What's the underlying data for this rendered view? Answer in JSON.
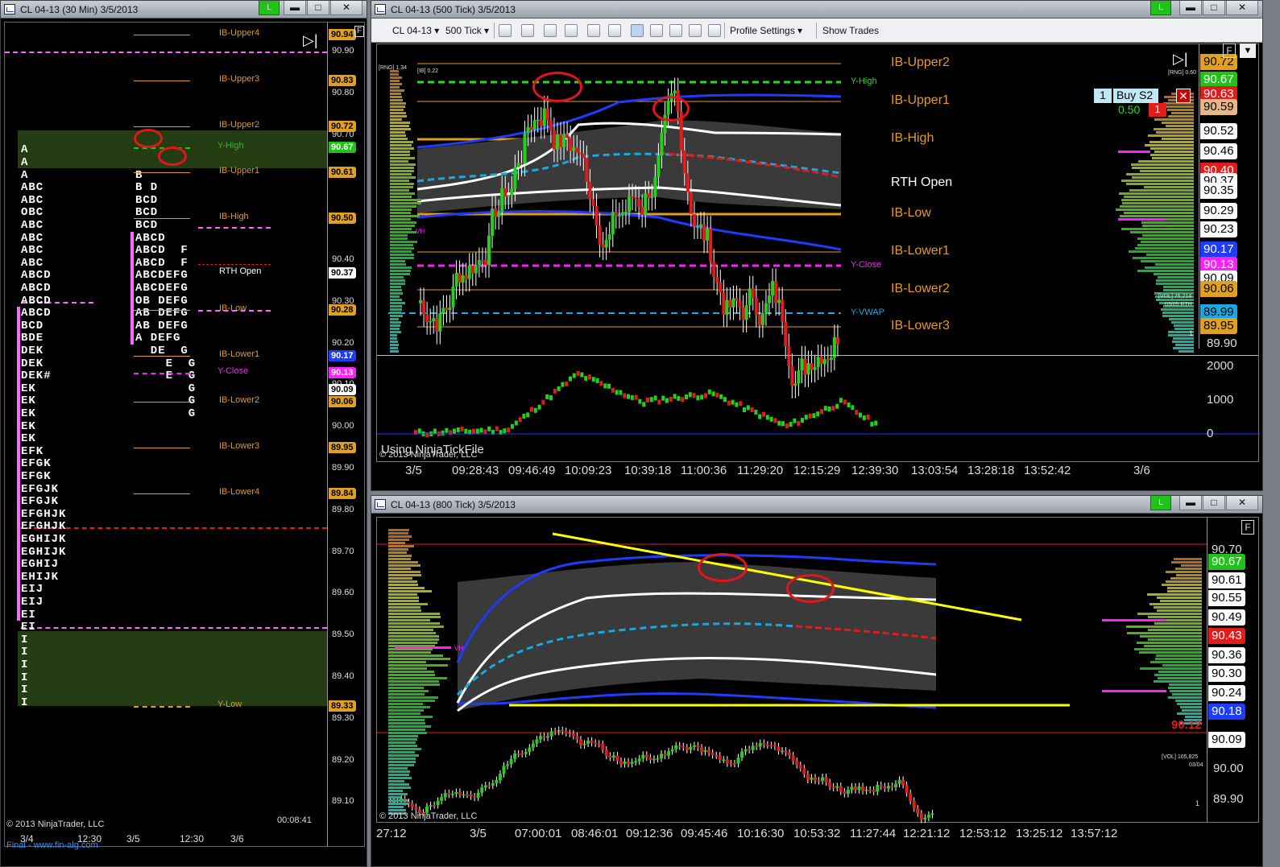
{
  "left": {
    "title": "CL 04-13 (30 Min)  3/5/2013",
    "btn_green": "L",
    "btn_min": "▬",
    "btn_max": "□",
    "btn_close": "✕",
    "levels": [
      {
        "name": "IB-Upper4",
        "price": 90.94,
        "color": "#e39b1f"
      },
      {
        "name": "IB-Upper3",
        "price": 90.83,
        "color": "#e39b1f"
      },
      {
        "name": "IB-Upper2",
        "price": 90.72,
        "color": "#e39b1f"
      },
      {
        "name": "Y-High",
        "price": 90.67,
        "color": "#22c21a"
      },
      {
        "name": "IB-Upper1",
        "price": 90.61,
        "color": "#e39b1f"
      },
      {
        "name": "IB-High",
        "price": 90.5,
        "color": "#e39b1f"
      },
      {
        "name": "RTH Open",
        "price": 90.37,
        "color": "#ffffff"
      },
      {
        "name": "IB-Low",
        "price": 90.28,
        "color": "#e39b1f"
      },
      {
        "name": "IB-Lower1",
        "price": 90.17,
        "color": "#e39b1f"
      },
      {
        "name": "Y-Close",
        "price": 90.13,
        "color": "#ff20ff"
      },
      {
        "name": "IB-Lower2",
        "price": 90.06,
        "color": "#e39b1f"
      },
      {
        "name": "IB-Lower3",
        "price": 89.95,
        "color": "#e39b1f"
      },
      {
        "name": "IB-Lower4",
        "price": 89.84,
        "color": "#e39b1f"
      },
      {
        "name": "Y-Low",
        "price": 89.33,
        "color": "#e39b1f"
      }
    ],
    "boxes": [
      "90.94",
      "90.83",
      "90.72",
      "90.67",
      "90.61",
      "90.50",
      "90.37",
      "90.28",
      "90.17",
      "90.13",
      "90.09",
      "90.06",
      "89.95",
      "89.84",
      "89.33"
    ],
    "yaxis": [
      "90.90",
      "90.80",
      "90.70",
      "90.60",
      "90.50",
      "90.40",
      "90.30",
      "90.20",
      "90.10",
      "90.00",
      "89.90",
      "89.80",
      "89.70",
      "89.60",
      "89.50",
      "89.40",
      "89.30",
      "89.20",
      "89.10"
    ],
    "tpo_left": [
      "A",
      "A",
      "A",
      "ABC",
      "ABC",
      "OBC",
      "ABC",
      "ABC",
      "ABC",
      "ABC",
      "ABCD",
      "ABCD",
      "ABCD",
      "ABCD",
      "BCD",
      "BDE",
      "DEK",
      "DEK",
      "DEK#",
      "EK",
      "EK",
      "EK",
      "EK",
      "EK",
      "EFK",
      "EFGK",
      "EFGK",
      "EFGJK",
      "EFGJK",
      "EFGHJK",
      "EFGHJK",
      "EGHIJK",
      "EGHIJK",
      "EGHIJ",
      "EHIJK",
      "EIJ",
      "EIJ",
      "EI",
      "EI",
      "I",
      "I",
      "I",
      "I",
      "I",
      "I"
    ],
    "tpo_right": [
      "",
      "B",
      "B D",
      "BCD",
      "BCD",
      "BCD",
      "ABCD",
      "ABCD  F",
      "ABCD  F",
      "ABCDEFG",
      "ABCDEFG",
      "OB DEFG",
      "AB DEFG",
      "AB DEFG",
      "A DEFG",
      "  DE  G",
      "    E  G",
      "    E  G",
      "       G",
      "       G",
      "       G"
    ],
    "xaxis": [
      "3/4",
      "12:30",
      "3/5",
      "12:30",
      "3/6"
    ],
    "copyright": "© 2013 NinjaTrader, LLC",
    "timer": "00:08:41",
    "footer": "Final - www.fin-alg.com"
  },
  "top": {
    "title": "CL 04-13 (500 Tick)  3/5/2013",
    "btn_green": "L",
    "btn_min": "▬",
    "btn_max": "□",
    "btn_close": "✕",
    "toolbar": {
      "instrument": "CL 04-13",
      "interval": "500 Tick",
      "profile": "Profile Settings",
      "trades": "Show Trades"
    },
    "levels": [
      {
        "name": "IB-Upper2",
        "color": "#e39b1f"
      },
      {
        "name": "IB-Upper1",
        "color": "#e39b1f"
      },
      {
        "name": "IB-High",
        "color": "#e39b1f"
      },
      {
        "name": "RTH Open",
        "color": "#ffffff"
      },
      {
        "name": "IB-Low",
        "color": "#e39b1f"
      },
      {
        "name": "IB-Lower1",
        "color": "#e39b1f"
      },
      {
        "name": "IB-Lower2",
        "color": "#e39b1f"
      },
      {
        "name": "IB-Lower3",
        "color": "#e39b1f"
      }
    ],
    "small_levels": [
      "Y-High",
      "Y-Close",
      "Y-VWAP"
    ],
    "rng": "[RNG] 1.34",
    "ib": "[IB] 0.22",
    "vh": "VH",
    "boxes": [
      "90.72",
      "90.67",
      "90.63",
      "90.59",
      "90.52",
      "90.46",
      "90.40",
      "90.37",
      "90.35",
      "90.29",
      "90.23",
      "90.17",
      "90.13",
      "90.09",
      "90.06",
      "89.99",
      "89.95"
    ],
    "yaxis_end": "89.90",
    "order": {
      "qty": "1",
      "label": "Buy S2",
      "pnl": "0.50",
      "qty2": "1"
    },
    "rng_right": "[RNG] 0.60",
    "vol": "[VOL] 76,214",
    "vol_date": "03/05 RTH",
    "one": "1",
    "vol_axis": [
      "2000",
      "1000",
      "0"
    ],
    "xaxis": [
      "3/5",
      "09:28:43",
      "09:46:49",
      "10:09:23",
      "10:39:18",
      "11:00:36",
      "11:29:20",
      "12:15:29",
      "12:39:30",
      "13:03:54",
      "13:28:18",
      "13:52:42",
      "3/6"
    ],
    "watermark": "Using NinjaTickFile",
    "copyright": "© 2013 NinjaTrader, LLC"
  },
  "bottom": {
    "title": "CL 04-13 (800 Tick)  3/5/2013",
    "btn_green": "L",
    "btn_min": "▬",
    "btn_max": "□",
    "btn_close": "✕",
    "boxes": [
      "90.70",
      "90.67",
      "90.61",
      "90.55",
      "90.49",
      "90.43",
      "90.36",
      "90.30",
      "90.24",
      "90.18",
      "90.09"
    ],
    "yaxis": [
      "90.00",
      "89.90"
    ],
    "price_red": "90.12",
    "vh": "VH",
    "vol": "[VOL] 105,825",
    "vol_date": "03/04",
    "one": "1",
    "xaxis": [
      "27:12",
      "3/5",
      "07:00:01",
      "08:46:01",
      "09:12:36",
      "09:45:46",
      "10:16:30",
      "10:53:32",
      "11:27:44",
      "12:21:12",
      "12:53:12",
      "13:25:12",
      "13:57:12"
    ],
    "copyright": "© 2013 NinjaTrader, LLC"
  }
}
